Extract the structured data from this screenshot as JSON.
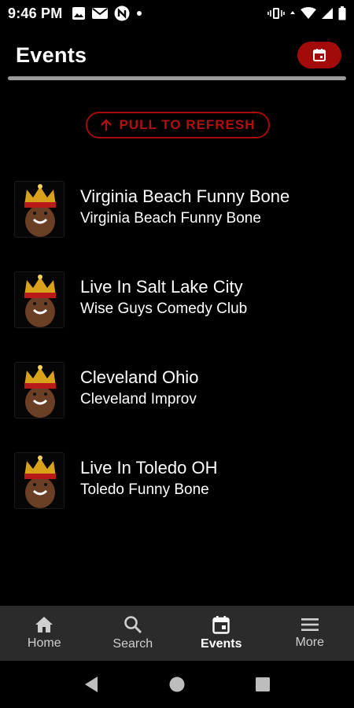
{
  "status_bar": {
    "time": "9:46 PM",
    "left_icons": [
      "image-icon",
      "mail-icon",
      "n-badge-icon",
      "dot-icon"
    ],
    "right_icons": [
      "vibrate-icon",
      "data-arrows-icon",
      "wifi-icon",
      "signal-icon",
      "battery-icon"
    ]
  },
  "header": {
    "title": "Events",
    "calendar_icon": "calendar-icon"
  },
  "refresh": {
    "label": "PULL TO REFRESH",
    "icon": "arrow-up-icon"
  },
  "events": [
    {
      "title": "Virginia Beach Funny Bone",
      "venue": "Virginia Beach Funny Bone"
    },
    {
      "title": "Live In Salt Lake City",
      "venue": "Wise Guys Comedy Club"
    },
    {
      "title": "Cleveland Ohio",
      "venue": "Cleveland Improv"
    },
    {
      "title": "Live In Toledo OH",
      "venue": "Toledo Funny Bone"
    }
  ],
  "bottom_nav": {
    "items": [
      {
        "label": "Home",
        "icon": "home-icon"
      },
      {
        "label": "Search",
        "icon": "search-icon"
      },
      {
        "label": "Events",
        "icon": "calendar-icon",
        "active": true
      },
      {
        "label": "More",
        "icon": "menu-icon"
      }
    ]
  },
  "system_nav": [
    "back-icon",
    "home-circle-icon",
    "recents-icon"
  ],
  "colors": {
    "accent": "#a30b0b",
    "background": "#000000",
    "nav_bar": "#2b2b2b",
    "divider": "#9a9a9a"
  }
}
